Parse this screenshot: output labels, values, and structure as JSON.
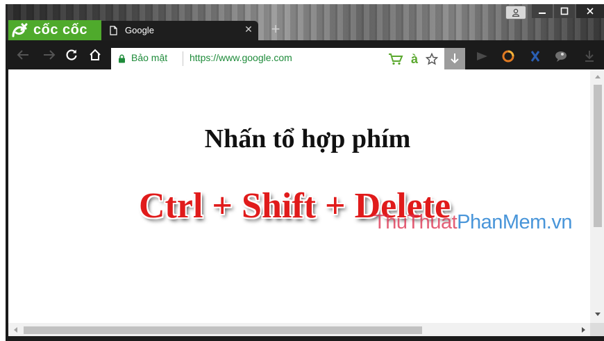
{
  "browser": {
    "brand_name": "cốc cốc",
    "tab": {
      "title": "Google"
    },
    "new_tab_symbol": "+",
    "close_symbol": "✕"
  },
  "omnibox": {
    "security_label": "Bảo mật",
    "url": "https://www.google.com",
    "translate_glyph": "à"
  },
  "page": {
    "heading": "Nhấn tổ hợp phím",
    "shortcut": "Ctrl + Shift + Delete",
    "watermark": {
      "part1": "ThuThuat",
      "part2": "PhanMem.vn"
    }
  },
  "colors": {
    "brand_green": "#4faa2c",
    "secure_green": "#1e8b3a",
    "shortcut_red": "#e01b1b",
    "watermark_red": "#dc3250",
    "watermark_blue": "#2882d2"
  },
  "icons": [
    "coccoc-logo-icon",
    "page-icon",
    "user-icon",
    "minimize-icon",
    "maximize-icon",
    "close-icon",
    "back-icon",
    "forward-icon",
    "reload-icon",
    "home-icon",
    "lock-icon",
    "cart-icon",
    "translate-icon",
    "star-icon",
    "download-icon",
    "play-extension-icon",
    "circle-extension-icon",
    "x-extension-icon",
    "chat-extension-icon",
    "menu-download-icon"
  ]
}
